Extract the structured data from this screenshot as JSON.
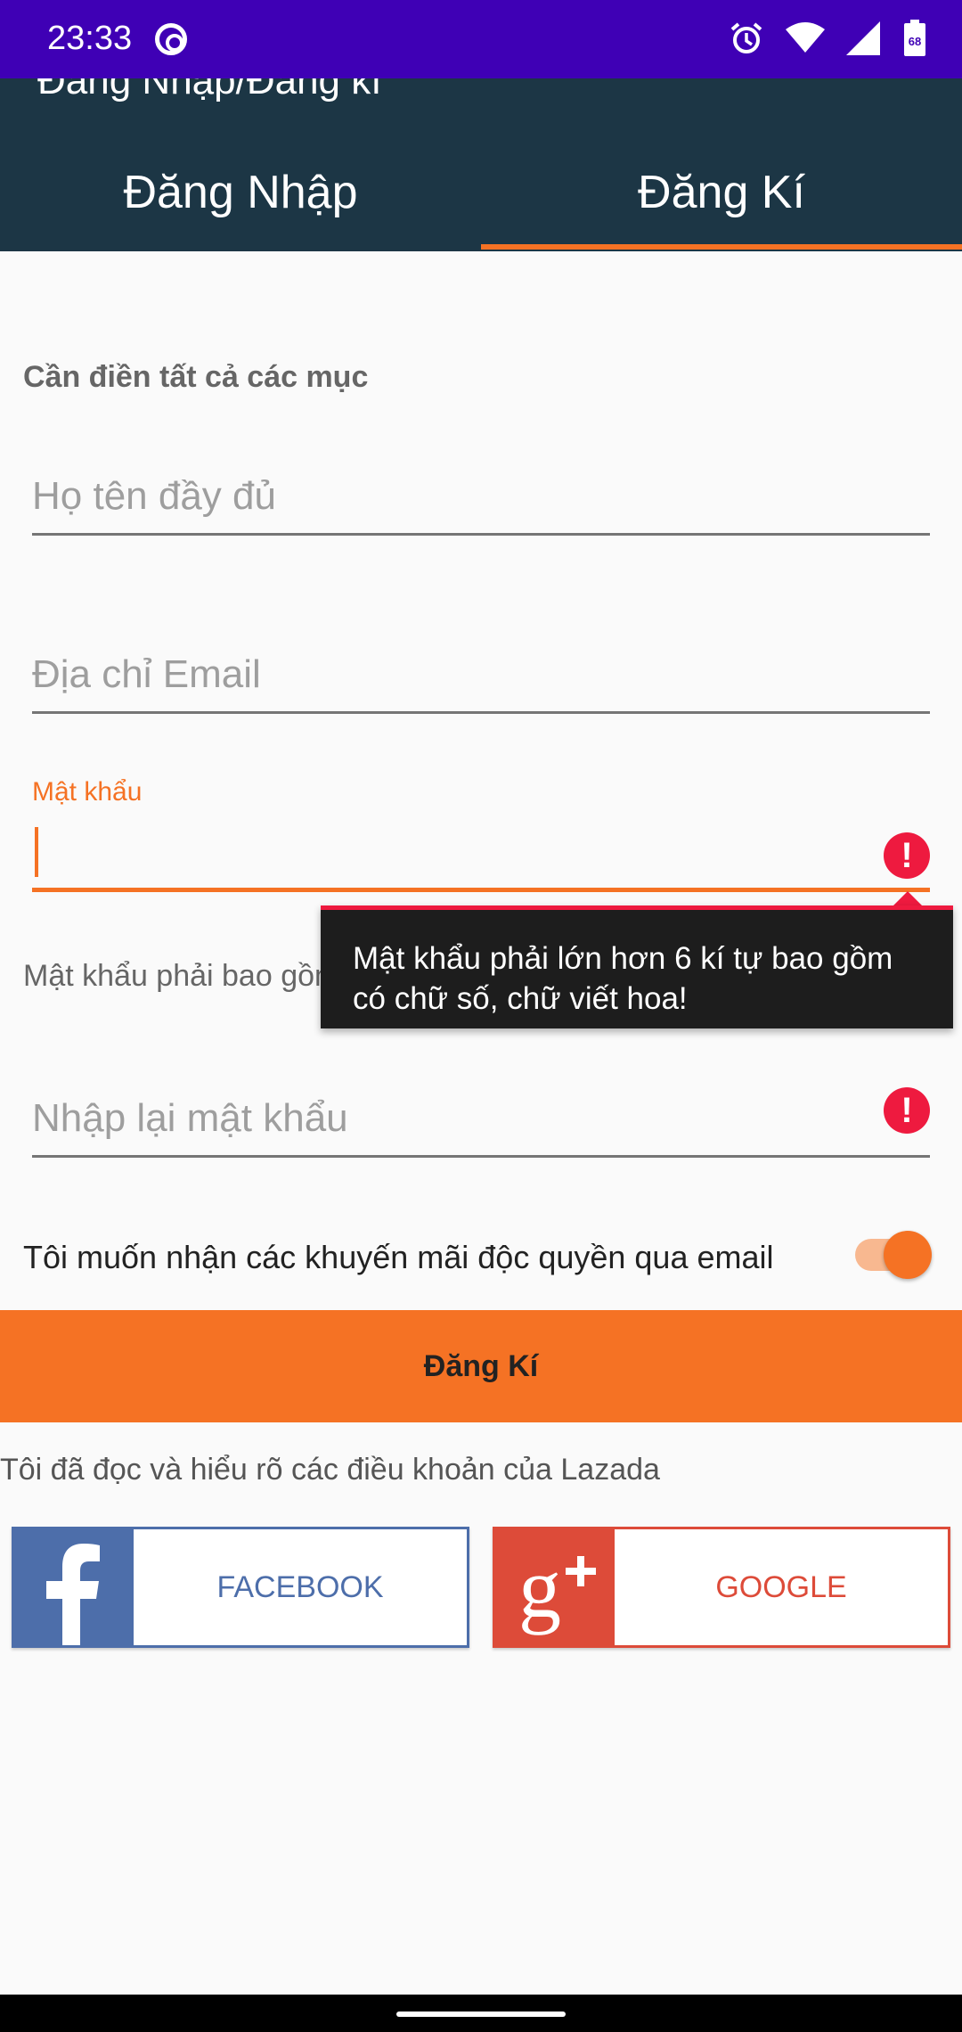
{
  "status": {
    "time": "23:33",
    "battery": "68"
  },
  "appbar": {
    "title": "Đăng Nhập/Đăng kí"
  },
  "tabs": [
    {
      "label": "Đăng Nhập",
      "active": false
    },
    {
      "label": "Đăng Kí",
      "active": true
    }
  ],
  "form": {
    "required_note": "Cần điền tất cả các mục",
    "name_placeholder": "Họ tên đầy đủ",
    "email_placeholder": "Địa chỉ Email",
    "password_label": "Mật khẩu",
    "password_hint": "Mật khẩu phải bao gồm chữ số và chữ viết hoa",
    "password_error": "Mật khẩu phải lớn hơn 6 kí tự bao gồm có chữ số, chữ viết hoa!",
    "confirm_placeholder": "Nhập lại mật khẩu",
    "promo_label": "Tôi muốn nhận các khuyến mãi độc quyền qua email",
    "promo_enabled": true,
    "submit_label": "Đăng Kí",
    "terms_text": "Tôi đã đọc và hiểu rõ các điều khoản của Lazada"
  },
  "social": {
    "facebook_label": "FACEBOOK",
    "google_label": "GOOGLE"
  },
  "colors": {
    "accent": "#f57224",
    "appbar": "#1c3645",
    "statusbar": "#3f00b5",
    "error": "#ee1a3f",
    "facebook": "#4d6eaa",
    "google": "#dd4b39"
  }
}
